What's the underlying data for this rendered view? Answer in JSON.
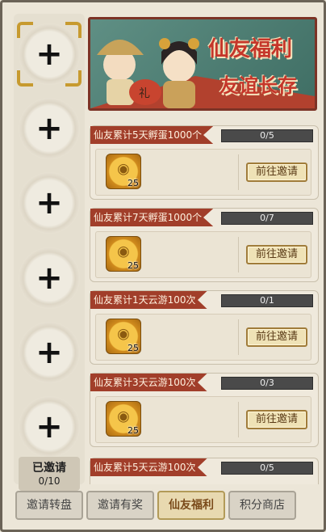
{
  "banner": {
    "title_line1": "仙友福利",
    "title_line2": "友谊长存",
    "gift_char": "礼"
  },
  "invite_slots": [
    {
      "icon": "plus-icon",
      "selected": true
    },
    {
      "icon": "plus-icon",
      "selected": false
    },
    {
      "icon": "plus-icon",
      "selected": false
    },
    {
      "icon": "plus-icon",
      "selected": false
    },
    {
      "icon": "plus-icon",
      "selected": false
    },
    {
      "icon": "plus-icon",
      "selected": false
    }
  ],
  "invited": {
    "label": "已邀请",
    "count": "0/10"
  },
  "tasks": [
    {
      "title": "仙友累计5天孵蛋1000个",
      "progress": "0/5",
      "reward_count": "25",
      "button": "前往邀请"
    },
    {
      "title": "仙友累计7天孵蛋1000个",
      "progress": "0/7",
      "reward_count": "25",
      "button": "前往邀请"
    },
    {
      "title": "仙友累计1天云游100次",
      "progress": "0/1",
      "reward_count": "25",
      "button": "前往邀请"
    },
    {
      "title": "仙友累计3天云游100次",
      "progress": "0/3",
      "reward_count": "25",
      "button": "前往邀请"
    },
    {
      "title": "仙友累计5天云游100次",
      "progress": "0/5"
    }
  ],
  "tabs": [
    {
      "label": "邀请转盘",
      "active": false
    },
    {
      "label": "邀请有奖",
      "active": false
    },
    {
      "label": "仙友福利",
      "active": true
    },
    {
      "label": "积分商店",
      "active": false
    }
  ],
  "colors": {
    "accent_red": "#a13e2a",
    "gold": "#c79a2f",
    "banner_teal": "#4f7f74"
  }
}
